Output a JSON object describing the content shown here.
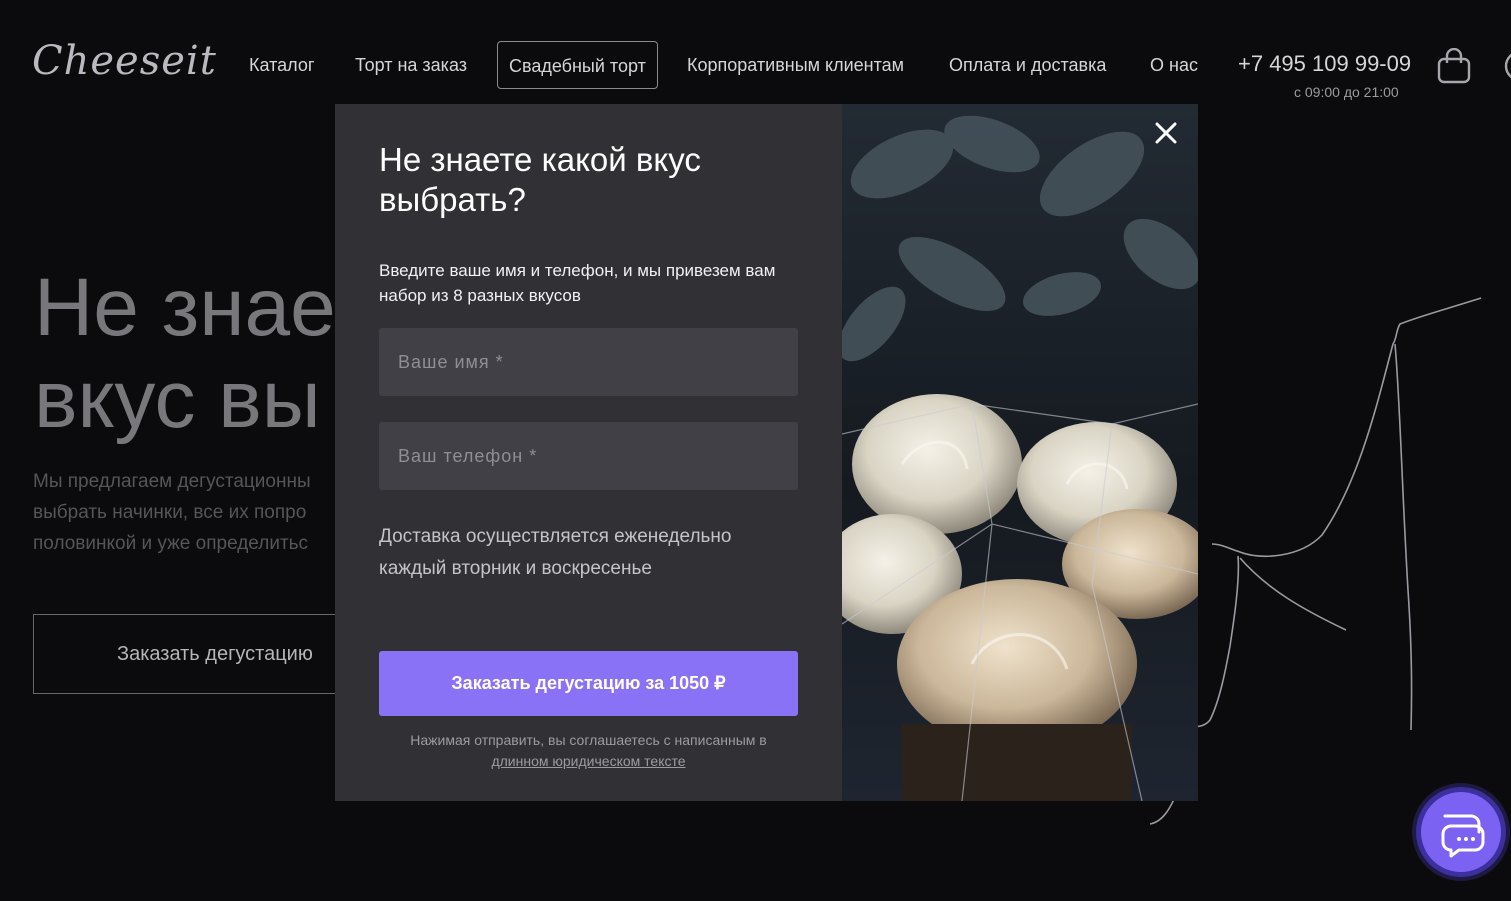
{
  "header": {
    "logo_text": "Cheeseit",
    "nav": [
      {
        "label": "Каталог"
      },
      {
        "label": "Торт на заказ"
      },
      {
        "label": "Свадебный торт"
      },
      {
        "label": "Корпоративным клиентам"
      },
      {
        "label": "Оплата и доставка"
      },
      {
        "label": "О нас"
      }
    ],
    "active_nav": "Свадебный торт",
    "phone": "+7 495 109 99-09",
    "hours": "с 09:00 до 21:00"
  },
  "hero": {
    "title_line1": "Не знае",
    "title_line2": "вкус вы",
    "text_line1": "Мы предлагаем дегустационны",
    "text_line2": "выбрать начинки, все их попро",
    "text_line3": "половинкой и уже определитьс",
    "button_label": "Заказать дегустацию"
  },
  "modal": {
    "title": "Не знаете какой вкус выбрать?",
    "description": "Введите ваше имя и телефон, и мы привезем вам набор из 8 разных вкусов",
    "name_placeholder": "Ваше имя *",
    "phone_placeholder": "Ваш телефон *",
    "delivery_note": "Доставка осуществляется еженедельно каждый вторник и воскресенье",
    "submit_label": "Заказать дегустацию за 1050 ₽",
    "legal_text": "Нажимая отправить, вы соглашаетесь с написанным в",
    "legal_link": "длинном юридическом тексте"
  },
  "icons": {
    "cart": "shopping-bag-icon",
    "close": "close-icon",
    "chat": "chat-bubbles-icon"
  },
  "colors": {
    "accent": "#8a72f7",
    "panel": "#313135",
    "background": "#0b0b0d"
  }
}
